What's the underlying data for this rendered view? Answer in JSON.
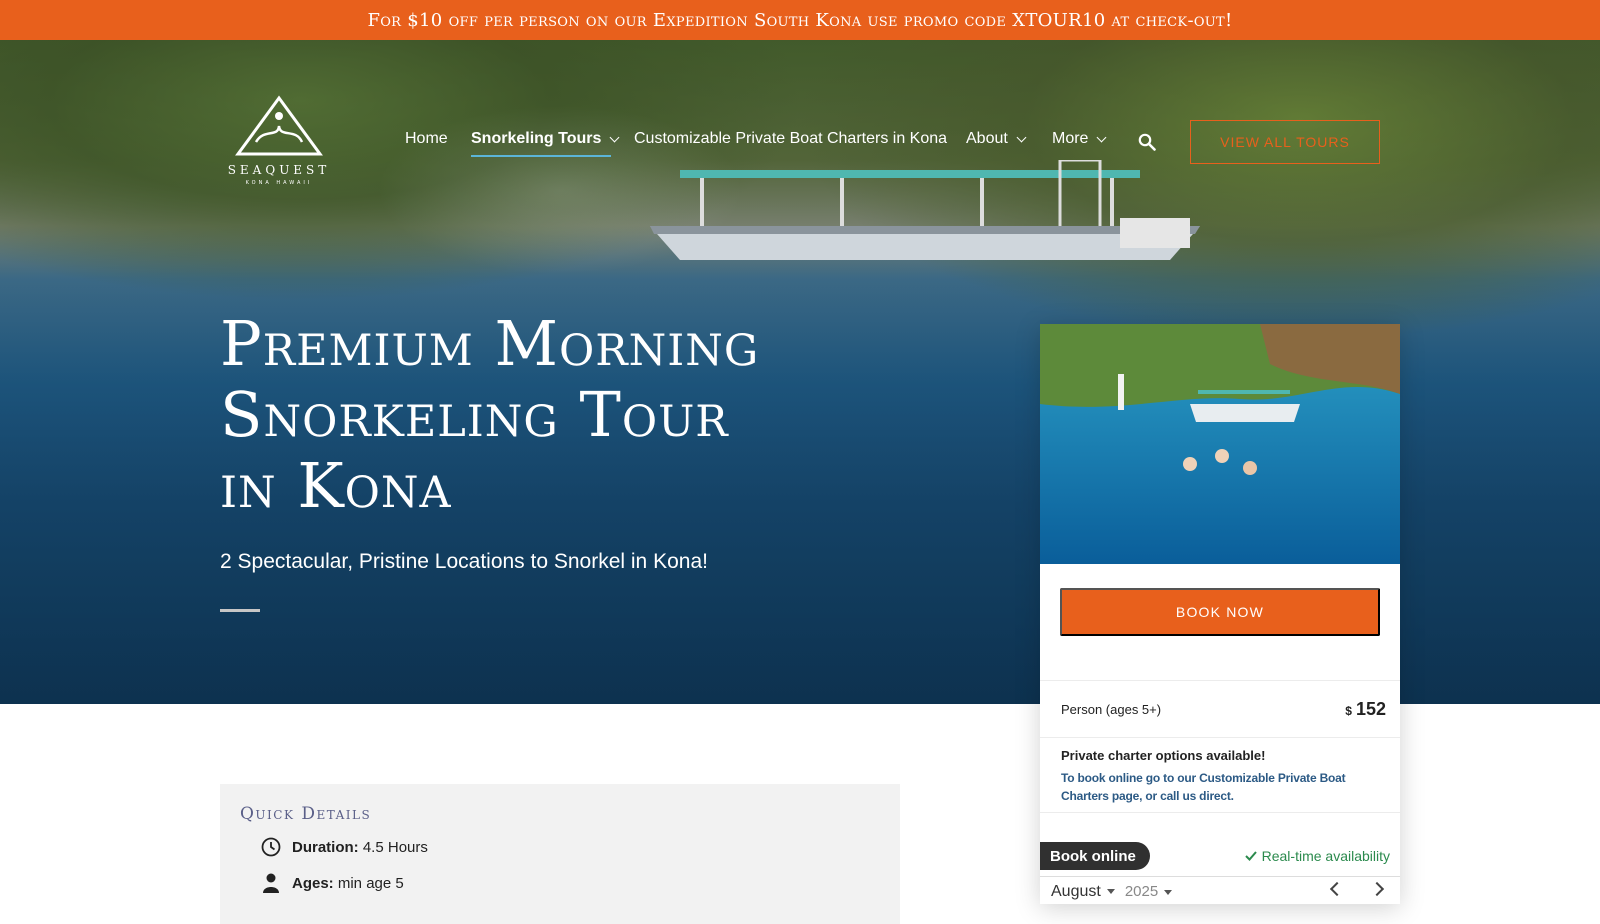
{
  "promo_bar": {
    "text": "For $10 off per person on our Expedition South Kona use promo code XTOUR10 at check-out!"
  },
  "header": {
    "logo_text": "SEAQUEST",
    "logo_subtext": "KONA HAWAII",
    "nav": [
      {
        "label": "Home",
        "has_dropdown": false,
        "active": false
      },
      {
        "label": "Snorkeling Tours",
        "has_dropdown": true,
        "active": true
      },
      {
        "label": "Customizable Private Boat Charters in Kona",
        "has_dropdown": false,
        "active": false
      },
      {
        "label": "About",
        "has_dropdown": true,
        "active": false
      },
      {
        "label": "More",
        "has_dropdown": true,
        "active": false
      }
    ],
    "cta_label": "VIEW ALL TOURS"
  },
  "hero": {
    "title_lines": [
      "Premium Morning",
      "Snorkeling Tour",
      "in Kona"
    ],
    "subtitle": "2 Spectacular, Pristine Locations to Snorkel in Kona!"
  },
  "booking_card": {
    "book_now_label": "BOOK NOW",
    "price_label": "Person (ages 5+)",
    "currency": "$",
    "price": "152",
    "charter_title": "Private charter options available!",
    "charter_text": "To book online go to our Customizable Private Boat Charters page, or call us direct.",
    "book_online_label": "Book online",
    "realtime_label": "Real-time availability",
    "calendar_month": "August",
    "calendar_year": "2025"
  },
  "quick_details": {
    "title": "Quick Details",
    "items": [
      {
        "icon": "clock-icon",
        "label": "Duration:",
        "value": "4.5 Hours"
      },
      {
        "icon": "person-icon",
        "label": "Ages:",
        "value": "min age 5"
      }
    ]
  },
  "colors": {
    "accent": "#e8601c",
    "link_blue": "#2c5a85",
    "available_green": "#2b8a4d",
    "nav_underline": "#5bb5d9"
  }
}
